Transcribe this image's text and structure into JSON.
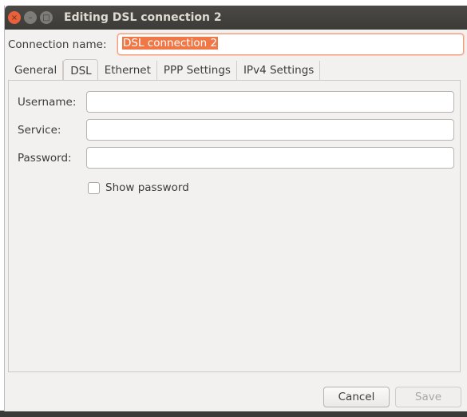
{
  "window": {
    "title": "Editing DSL connection 2"
  },
  "connection_name": {
    "label": "Connection name:",
    "value": "DSL connection 2"
  },
  "tabs": [
    {
      "label": "General"
    },
    {
      "label": "DSL",
      "active": true
    },
    {
      "label": "Ethernet"
    },
    {
      "label": "PPP Settings"
    },
    {
      "label": "IPv4 Settings"
    }
  ],
  "dsl": {
    "username_label": "Username:",
    "username": "",
    "service_label": "Service:",
    "service": "",
    "password_label": "Password:",
    "password": "",
    "show_password": "Show password",
    "show_password_checked": false
  },
  "buttons": {
    "cancel": "Cancel",
    "save": "Save",
    "save_enabled": false
  },
  "colors": {
    "accent": "#f07746",
    "titlebar": "#3c3b37"
  }
}
